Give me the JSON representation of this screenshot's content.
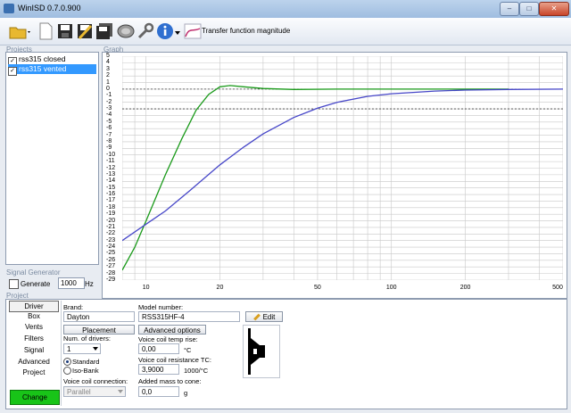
{
  "window": {
    "title": "WinISD 0.7.0.900",
    "buttons": [
      "–",
      "□",
      "✕"
    ]
  },
  "toolbar": {
    "label": "Transfer function magnitude"
  },
  "sections": {
    "projects": "Projects",
    "graph": "Graph",
    "signal_generator": "Signal Generator",
    "project": "Project"
  },
  "projects": [
    {
      "name": "rss315 closed",
      "checked": true,
      "selected": false
    },
    {
      "name": "rss315 vented",
      "checked": true,
      "selected": true
    }
  ],
  "signal_generator": {
    "generate_label": "Generate",
    "frequency": "1000",
    "unit": "Hz"
  },
  "tabs": [
    "Driver",
    "Box",
    "Vents",
    "Filters",
    "Signal",
    "Advanced",
    "Project"
  ],
  "change_label": "Change",
  "driver": {
    "brand_label": "Brand:",
    "brand": "Dayton",
    "model_label": "Model number:",
    "model": "RSS315HF-4",
    "edit_label": "Edit",
    "placement_label": "Placement",
    "num_drivers_label": "Num. of drivers:",
    "num_drivers": "1",
    "standard_label": "Standard",
    "isobank_label": "Iso-Bank",
    "voice_coil_conn_label": "Voice coil connection:",
    "voice_coil_conn": "Parallel",
    "advanced_label": "Advanced options",
    "vc_temp_label": "Voice coil temp rise:",
    "vc_temp": "0,00",
    "vc_temp_unit": "°C",
    "vc_res_label": "Voice coil resistance TC:",
    "vc_res": "3,9000",
    "vc_res_unit": "1000/°C",
    "mass_label": "Added mass to cone:",
    "mass": "0,0",
    "mass_unit": "g"
  },
  "chart_data": {
    "type": "line",
    "title": "",
    "xlabel": "",
    "ylabel": "",
    "x_scale": "log",
    "xlim": [
      8,
      500
    ],
    "ylim": [
      -29,
      5
    ],
    "x_ticks": [
      10,
      20,
      50,
      100,
      200,
      500
    ],
    "y_ticks": [
      5,
      4,
      3,
      2,
      1,
      0,
      -1,
      -2,
      -3,
      -4,
      -5,
      -6,
      -7,
      -8,
      -9,
      -10,
      -11,
      -12,
      -13,
      -14,
      -15,
      -16,
      -17,
      -18,
      -19,
      -20,
      -21,
      -22,
      -23,
      -24,
      -25,
      -26,
      -27,
      -28,
      -29
    ],
    "grid": true,
    "reference_lines": [
      0,
      -3
    ],
    "series": [
      {
        "color": "#1a9a1a",
        "x": [
          8,
          9,
          10,
          12,
          14,
          16,
          18,
          20,
          22,
          25,
          30,
          40,
          60,
          100,
          200,
          300
        ],
        "y": [
          -27.5,
          -24,
          -20,
          -13,
          -7.5,
          -3.2,
          -0.8,
          0.35,
          0.55,
          0.35,
          0.1,
          -0.05,
          0,
          0,
          0,
          0
        ]
      },
      {
        "color": "#4646c8",
        "x": [
          8,
          10,
          12,
          15,
          20,
          25,
          30,
          40,
          50,
          60,
          80,
          100,
          150,
          200,
          300,
          500
        ],
        "y": [
          -23,
          -20.5,
          -18.5,
          -15.5,
          -11.5,
          -8.8,
          -6.8,
          -4.3,
          -2.9,
          -2.0,
          -1.1,
          -0.7,
          -0.3,
          -0.15,
          -0.05,
          0
        ]
      }
    ],
    "colors": {
      "reference": "#444444",
      "grid": "#c8c8c8"
    }
  }
}
